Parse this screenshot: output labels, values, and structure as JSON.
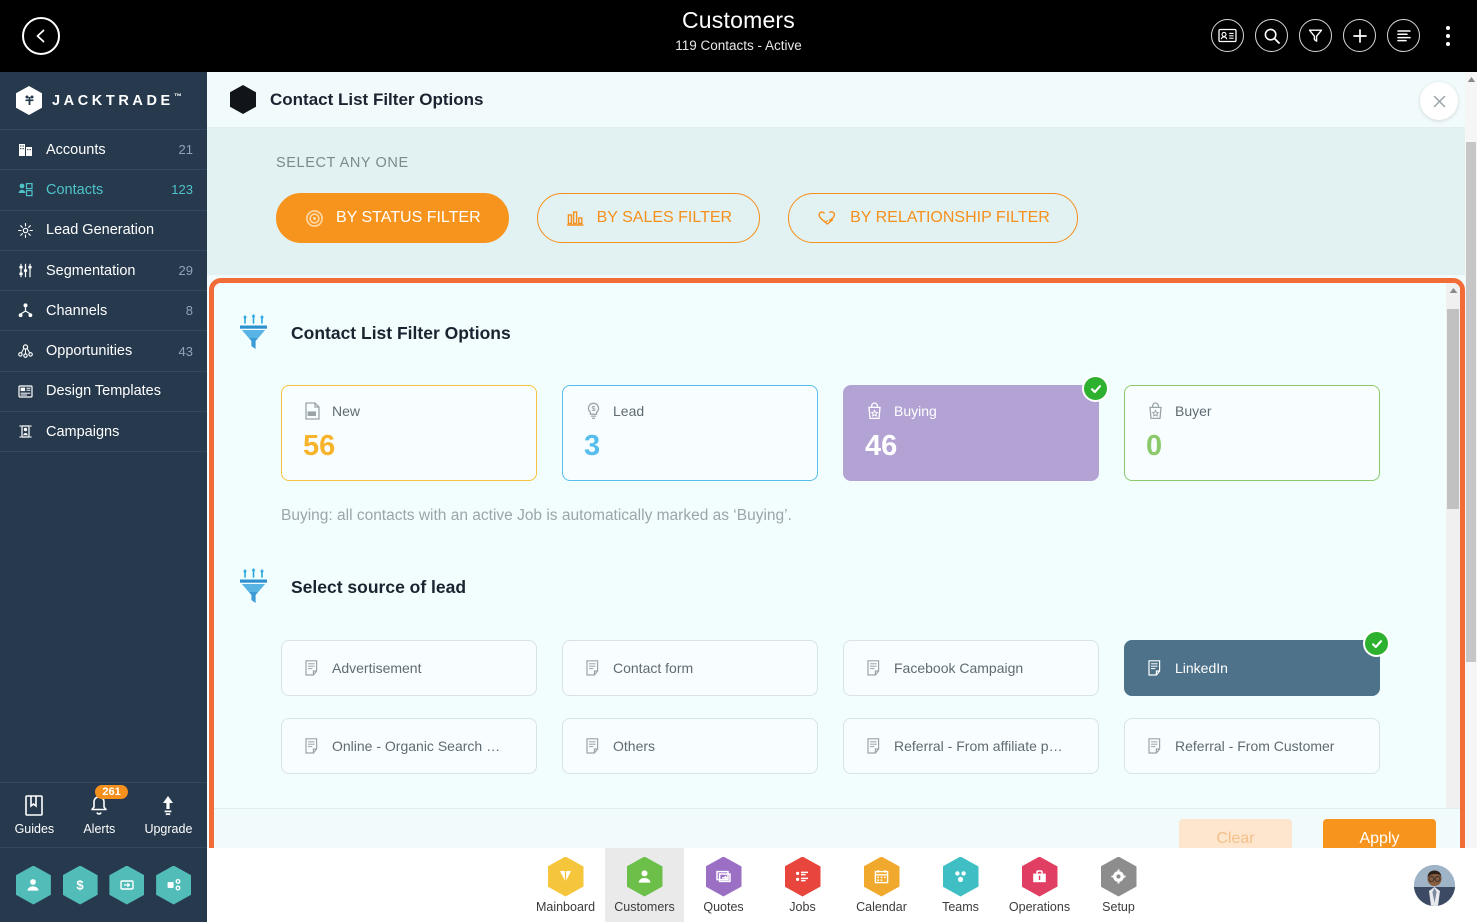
{
  "topbar": {
    "title": "Customers",
    "subtitle": "119 Contacts - Active",
    "back_icon": "chevron-left-icon",
    "actions": [
      {
        "name": "contact-card-icon",
        "label": "Contact Card"
      },
      {
        "name": "search-icon",
        "label": "Search"
      },
      {
        "name": "filter-funnel-icon",
        "label": "Filter"
      },
      {
        "name": "add-icon",
        "label": "Add"
      },
      {
        "name": "list-view-icon",
        "label": "List View"
      },
      {
        "name": "more-options-icon",
        "label": "More"
      }
    ]
  },
  "sidebar": {
    "brand": "JACKTRADE",
    "brand_tm": "™",
    "items": [
      {
        "label": "Accounts",
        "count": "21",
        "icon": "building-icon",
        "active": false
      },
      {
        "label": "Contacts",
        "count": "123",
        "icon": "contacts-icon",
        "active": true
      },
      {
        "label": "Lead Generation",
        "count": "",
        "icon": "lead-gen-icon",
        "active": false
      },
      {
        "label": "Segmentation",
        "count": "29",
        "icon": "segment-icon",
        "active": false
      },
      {
        "label": "Channels",
        "count": "8",
        "icon": "channels-icon",
        "active": false
      },
      {
        "label": "Opportunities",
        "count": "43",
        "icon": "opportunity-icon",
        "active": false
      },
      {
        "label": "Design Templates",
        "count": "",
        "icon": "template-icon",
        "active": false
      },
      {
        "label": "Campaigns",
        "count": "",
        "icon": "campaign-icon",
        "active": false
      }
    ],
    "utility": [
      {
        "label": "Guides",
        "icon": "book-icon",
        "badge": ""
      },
      {
        "label": "Alerts",
        "icon": "bell-icon",
        "badge": "261"
      },
      {
        "label": "Upgrade",
        "icon": "upload-arrow-icon",
        "badge": ""
      }
    ],
    "quick_actions": [
      {
        "name": "person-hex-icon"
      },
      {
        "name": "dollar-hex-icon"
      },
      {
        "name": "payment-hex-icon"
      },
      {
        "name": "workflow-hex-icon"
      }
    ]
  },
  "modal": {
    "title": "Contact List Filter Options",
    "close_icon": "close-icon",
    "select_any_one_label": "SELECT ANY ONE",
    "filter_tabs": [
      {
        "label": "BY STATUS FILTER",
        "icon": "status-target-icon",
        "active": true
      },
      {
        "label": "BY SALES FILTER",
        "icon": "bar-chart-icon",
        "active": false
      },
      {
        "label": "BY RELATIONSHIP FILTER",
        "icon": "handshake-heart-icon",
        "active": false
      }
    ],
    "status_section": {
      "title": "Contact List Filter Options",
      "icon": "funnel-icon",
      "cards": [
        {
          "label": "New",
          "value": "56",
          "icon": "new-doc-icon",
          "style": "new",
          "selected": false
        },
        {
          "label": "Lead",
          "value": "3",
          "icon": "lead-bulb-icon",
          "style": "lead",
          "selected": false
        },
        {
          "label": "Buying",
          "value": "46",
          "icon": "shopping-bag-icon",
          "style": "buying",
          "selected": true
        },
        {
          "label": "Buyer",
          "value": "0",
          "icon": "shopping-bag-icon",
          "style": "buyer",
          "selected": false
        }
      ],
      "hint": "Buying: all contacts with an active Job is automatically marked as ‘Buying’."
    },
    "source_section": {
      "title": "Select source of lead",
      "icon": "funnel-icon",
      "row1": [
        {
          "label": "Advertisement",
          "icon": "note-icon",
          "selected": false
        },
        {
          "label": "Contact form",
          "icon": "note-icon",
          "selected": false
        },
        {
          "label": "Facebook Campaign",
          "icon": "note-icon",
          "selected": false
        },
        {
          "label": "LinkedIn",
          "icon": "note-icon",
          "selected": true
        }
      ],
      "row2": [
        {
          "label": "Online - Organic Search …",
          "icon": "note-icon",
          "selected": false
        },
        {
          "label": "Others",
          "icon": "note-icon",
          "selected": false
        },
        {
          "label": "Referral - From affiliate p…",
          "icon": "note-icon",
          "selected": false
        },
        {
          "label": "Referral - From Customer",
          "icon": "note-icon",
          "selected": false
        }
      ]
    },
    "footer": {
      "clear_label": "Clear",
      "apply_label": "Apply"
    }
  },
  "bottom_nav": {
    "items": [
      {
        "label": "Mainboard",
        "icon": "mainboard-icon",
        "color": "#f5c63c",
        "active": false
      },
      {
        "label": "Customers",
        "icon": "customers-icon",
        "color": "#6cc04a",
        "active": true
      },
      {
        "label": "Quotes",
        "icon": "quotes-icon",
        "color": "#9b6fc4",
        "active": false
      },
      {
        "label": "Jobs",
        "icon": "jobs-icon",
        "color": "#e8453c",
        "active": false
      },
      {
        "label": "Calendar",
        "icon": "calendar-icon",
        "color": "#f0a92c",
        "active": false
      },
      {
        "label": "Teams",
        "icon": "teams-icon",
        "color": "#3fbfc4",
        "active": false
      },
      {
        "label": "Operations",
        "icon": "operations-icon",
        "color": "#e03e62",
        "active": false
      },
      {
        "label": "Setup",
        "icon": "setup-icon",
        "color": "#8d8d8d",
        "active": false
      }
    ],
    "avatar": "user-avatar"
  },
  "colors": {
    "accent_orange": "#f7941d",
    "highlight_border": "#f26c37",
    "sidebar_bg": "#26394d",
    "active_teal": "#4ec3c9",
    "selected_purple": "#b3a3d4",
    "selected_slate": "#4d7289",
    "check_green": "#2eb12e"
  }
}
